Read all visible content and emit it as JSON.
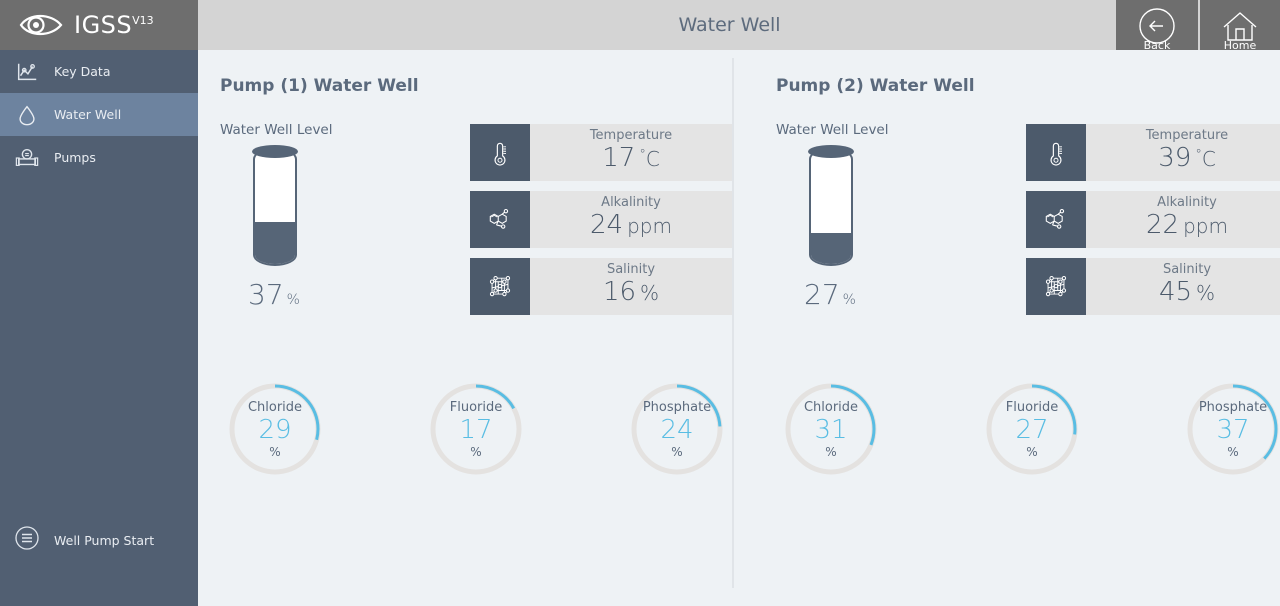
{
  "brand": {
    "name": "IGSS",
    "version": "V13",
    "logo_icon": "eye-icon",
    "logo_bg": "#6e6e6e"
  },
  "sidebar": {
    "bg": "#515f72",
    "active_bg": "#6d839f",
    "items": [
      {
        "label": "Key Data",
        "icon": "chart-icon",
        "active": false
      },
      {
        "label": "Water Well",
        "icon": "droplet-icon",
        "active": true
      },
      {
        "label": "Pumps",
        "icon": "pump-icon",
        "active": false
      }
    ],
    "action": {
      "label": "Well Pump Start",
      "icon": "menu-circle-icon"
    }
  },
  "header": {
    "title": "Water Well",
    "bg": "#d4d4d4",
    "buttons": [
      {
        "label": "Back",
        "icon": "arrow-left-circle-icon"
      },
      {
        "label": "Home",
        "icon": "home-icon"
      }
    ]
  },
  "theme": {
    "page_bg": "#eef2f5",
    "accent": "#59bde3",
    "dark": "#4c5a6b",
    "text": "#5b6a7d",
    "tile_bg": "#e4e4e4",
    "track": "#e4e2e0"
  },
  "panels": [
    {
      "title": "Pump (1) Water Well",
      "tank": {
        "label": "Water Well Level",
        "value": "37",
        "unit": "%",
        "percent": 37
      },
      "tiles": [
        {
          "label": "Temperature",
          "value": "17",
          "unit": "°C",
          "icon": "thermometer-icon"
        },
        {
          "label": "Alkalinity",
          "value": "24",
          "unit": "ppm",
          "icon": "molecule-icon"
        },
        {
          "label": "Salinity",
          "value": "16",
          "unit": "%",
          "icon": "lattice-icon"
        }
      ],
      "gauges": [
        {
          "label": "Chloride",
          "value": "29",
          "unit": "%",
          "percent": 29
        },
        {
          "label": "Fluoride",
          "value": "17",
          "unit": "%",
          "percent": 17
        },
        {
          "label": "Phosphate",
          "value": "24",
          "unit": "%",
          "percent": 24
        }
      ]
    },
    {
      "title": "Pump (2) Water Well",
      "tank": {
        "label": "Water Well Level",
        "value": "27",
        "unit": "%",
        "percent": 27
      },
      "tiles": [
        {
          "label": "Temperature",
          "value": "39",
          "unit": "°C",
          "icon": "thermometer-icon"
        },
        {
          "label": "Alkalinity",
          "value": "22",
          "unit": "ppm",
          "icon": "molecule-icon"
        },
        {
          "label": "Salinity",
          "value": "45",
          "unit": "%",
          "icon": "lattice-icon"
        }
      ],
      "gauges": [
        {
          "label": "Chloride",
          "value": "31",
          "unit": "%",
          "percent": 31
        },
        {
          "label": "Fluoride",
          "value": "27",
          "unit": "%",
          "percent": 27
        },
        {
          "label": "Phosphate",
          "value": "37",
          "unit": "%",
          "percent": 37
        }
      ]
    }
  ]
}
